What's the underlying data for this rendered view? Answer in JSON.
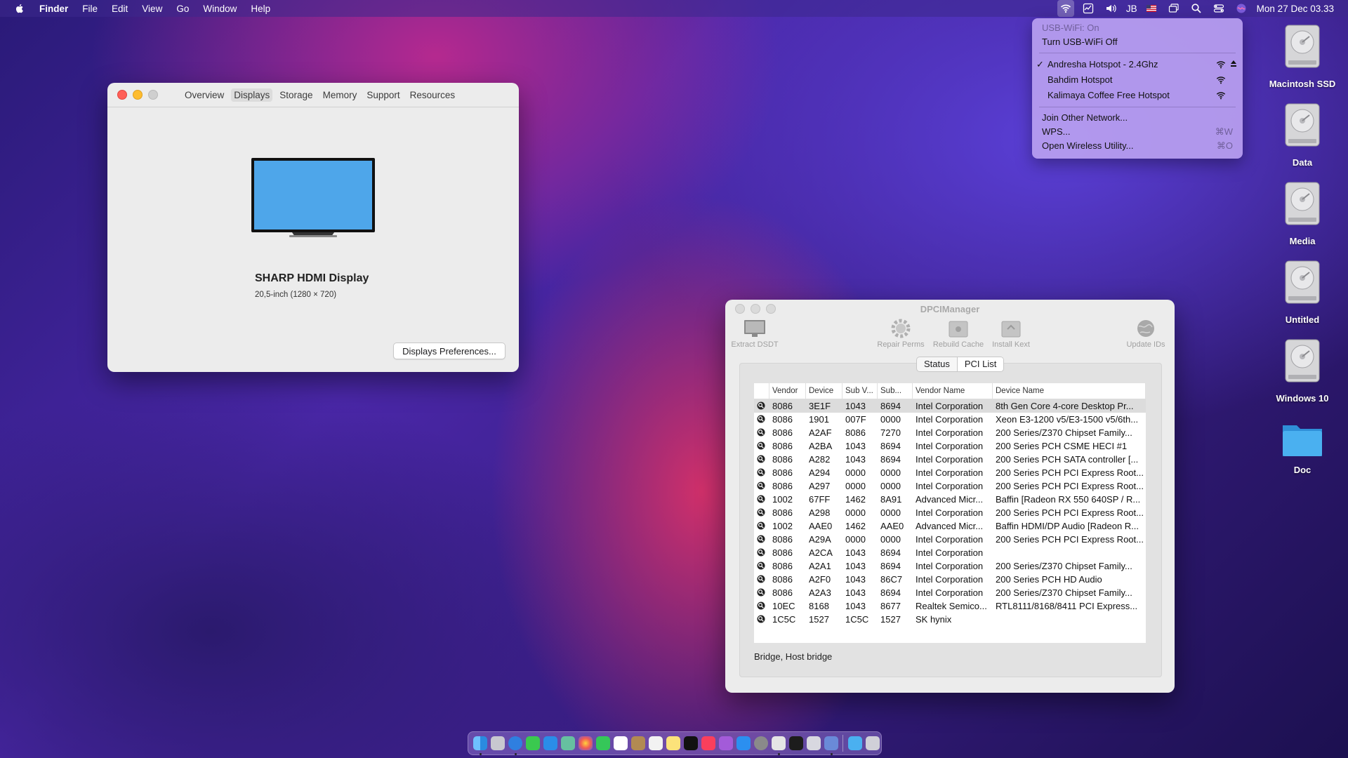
{
  "menubar": {
    "app": "Finder",
    "menus": [
      "File",
      "Edit",
      "View",
      "Go",
      "Window",
      "Help"
    ],
    "user_initials": "JB",
    "clock": "Mon 27 Dec  03.33"
  },
  "wifi_menu": {
    "status": "USB-WiFi: On",
    "toggle": "Turn USB-WiFi Off",
    "networks": [
      {
        "name": "Andresha Hotspot - 2.4Ghz",
        "connected": true,
        "locked": true
      },
      {
        "name": "Bahdim Hotspot",
        "connected": false,
        "locked": false
      },
      {
        "name": "Kalimaya Coffee Free Hotspot",
        "connected": false,
        "locked": false
      }
    ],
    "join_other": "Join Other Network...",
    "wps": "WPS...",
    "wps_shortcut": "⌘W",
    "open_utility": "Open Wireless Utility...",
    "open_utility_shortcut": "⌘O"
  },
  "desktop_icons": [
    "Macintosh SSD",
    "Data",
    "Media",
    "Untitled",
    "Windows 10",
    "Doc"
  ],
  "sysinfo": {
    "tabs": [
      "Overview",
      "Displays",
      "Storage",
      "Memory",
      "Support",
      "Resources"
    ],
    "selected_tab": "Displays",
    "display_name": "SHARP HDMI Display",
    "display_spec": "20,5-inch (1280 × 720)",
    "prefs_button": "Displays Preferences..."
  },
  "dpci": {
    "title": "DPCIManager",
    "toolbar": {
      "extract": "Extract DSDT",
      "repair": "Repair Perms",
      "rebuild": "Rebuild Cache",
      "install": "Install Kext",
      "update": "Update IDs"
    },
    "segments": [
      "Status",
      "PCI List"
    ],
    "selected_segment": "PCI List",
    "columns": [
      "Vendor",
      "Device",
      "Sub V...",
      "Sub...",
      "Vendor Name",
      "Device Name"
    ],
    "rows": [
      [
        "8086",
        "3E1F",
        "1043",
        "8694",
        "Intel Corporation",
        "8th Gen Core 4-core Desktop Pr..."
      ],
      [
        "8086",
        "1901",
        "007F",
        "0000",
        "Intel Corporation",
        "Xeon E3-1200 v5/E3-1500 v5/6th..."
      ],
      [
        "8086",
        "A2AF",
        "8086",
        "7270",
        "Intel Corporation",
        "200 Series/Z370 Chipset Family..."
      ],
      [
        "8086",
        "A2BA",
        "1043",
        "8694",
        "Intel Corporation",
        "200 Series PCH CSME HECI #1"
      ],
      [
        "8086",
        "A282",
        "1043",
        "8694",
        "Intel Corporation",
        "200 Series PCH SATA controller [..."
      ],
      [
        "8086",
        "A294",
        "0000",
        "0000",
        "Intel Corporation",
        "200 Series PCH PCI Express Root..."
      ],
      [
        "8086",
        "A297",
        "0000",
        "0000",
        "Intel Corporation",
        "200 Series PCH PCI Express Root..."
      ],
      [
        "1002",
        "67FF",
        "1462",
        "8A91",
        "Advanced Micr...",
        "Baffin [Radeon RX 550 640SP / R..."
      ],
      [
        "8086",
        "A298",
        "0000",
        "0000",
        "Intel Corporation",
        "200 Series PCH PCI Express Root..."
      ],
      [
        "1002",
        "AAE0",
        "1462",
        "AAE0",
        "Advanced Micr...",
        "Baffin HDMI/DP Audio [Radeon R..."
      ],
      [
        "8086",
        "A29A",
        "0000",
        "0000",
        "Intel Corporation",
        "200 Series PCH PCI Express Root..."
      ],
      [
        "8086",
        "A2CA",
        "1043",
        "8694",
        "Intel Corporation",
        ""
      ],
      [
        "8086",
        "A2A1",
        "1043",
        "8694",
        "Intel Corporation",
        "200 Series/Z370 Chipset Family..."
      ],
      [
        "8086",
        "A2F0",
        "1043",
        "86C7",
        "Intel Corporation",
        "200 Series PCH HD Audio"
      ],
      [
        "8086",
        "A2A3",
        "1043",
        "8694",
        "Intel Corporation",
        "200 Series/Z370 Chipset Family..."
      ],
      [
        "10EC",
        "8168",
        "1043",
        "8677",
        "Realtek Semico...",
        "RTL8111/8168/8411 PCI Express..."
      ],
      [
        "1C5C",
        "1527",
        "1C5C",
        "1527",
        "SK hynix",
        ""
      ]
    ],
    "status_line": "Bridge, Host bridge"
  },
  "colors": {
    "display_blue": "#4ea6ea",
    "folder_blue": "#3aa3ea",
    "traffic_red": "#ff5f57",
    "traffic_yellow": "#febc2e"
  }
}
